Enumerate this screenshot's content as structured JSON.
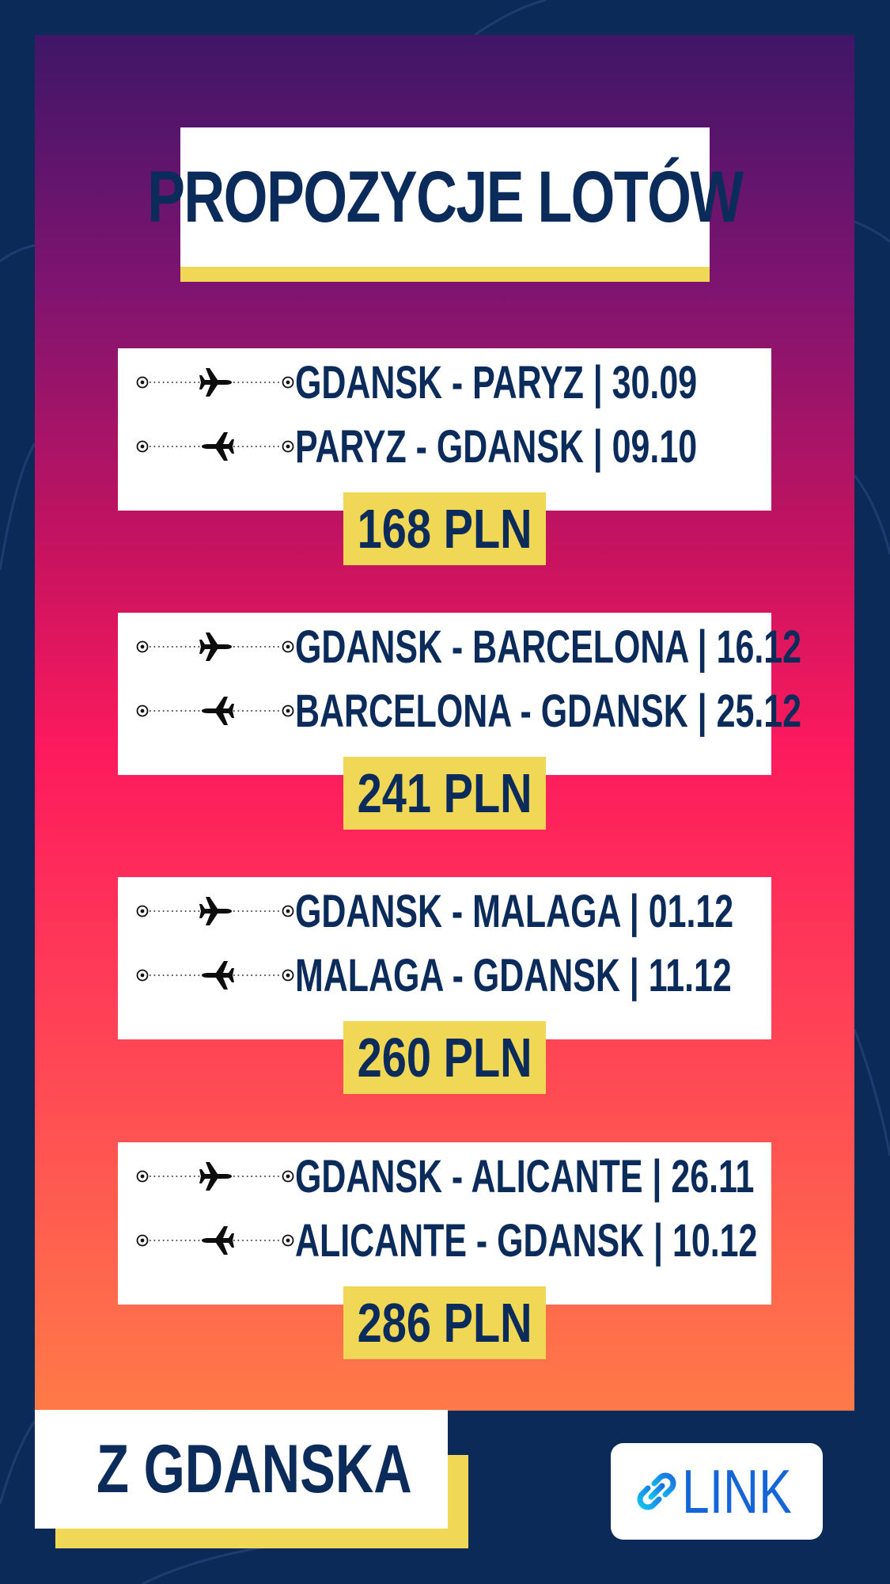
{
  "title": "PROPOZYCJE LOTÓW",
  "offers": [
    {
      "outbound": "GDANSK - PARYZ  |  30.09",
      "return": "PARYZ - GDANSK  |  09.10",
      "price": "168 PLN"
    },
    {
      "outbound": "GDANSK - BARCELONA  |  16.12",
      "return": "BARCELONA - GDANSK  |  25.12",
      "price": "241 PLN"
    },
    {
      "outbound": "GDANSK - MALAGA  |  01.12",
      "return": "MALAGA - GDANSK  |  11.12",
      "price": "260 PLN"
    },
    {
      "outbound": "GDANSK - ALICANTE  |  26.11",
      "return": "ALICANTE - GDANSK  |  10.12",
      "price": "286 PLN"
    }
  ],
  "footer": {
    "origin_label": "Z GDANSKA",
    "link_label": "LINK"
  },
  "icons": {
    "outbound": "plane-right-icon",
    "return": "plane-left-icon",
    "link": "link-chain-icon"
  },
  "colors": {
    "navy": "#0b2b5a",
    "background": "#0c2a58",
    "yellow": "#f0d756",
    "link_blue": "#1565d8",
    "gradient_top": "#3f1668",
    "gradient_mid": "#fd1a5d",
    "gradient_bottom": "#ff7a48"
  }
}
